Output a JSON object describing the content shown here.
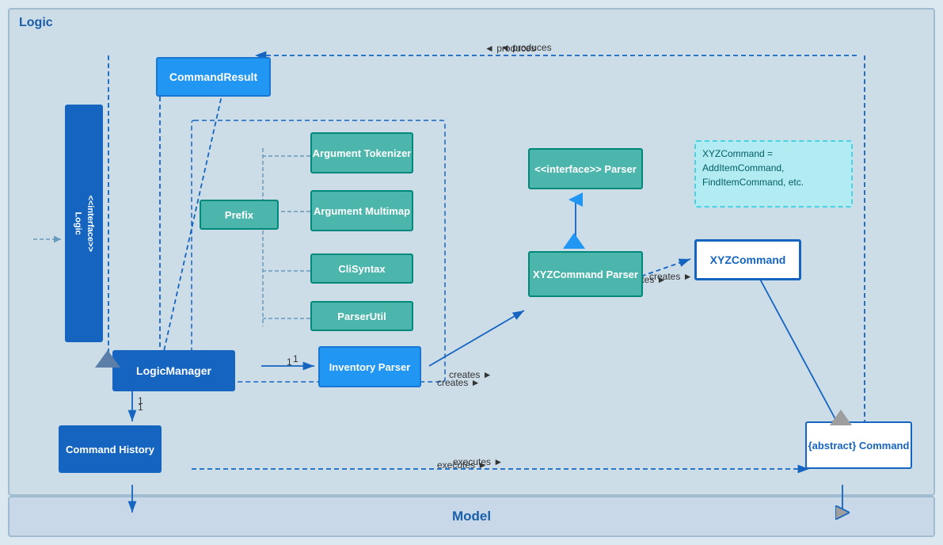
{
  "diagram": {
    "title": "Logic",
    "model_label": "Model",
    "boxes": {
      "command_result": "CommandResult",
      "logic_interface": "<<interface>>\nLogic",
      "argument_tokenizer": "Argument\nTokenizer",
      "argument_multimap": "Argument\nMultimap",
      "prefix": "Prefix",
      "cli_syntax": "CliSyntax",
      "parser_util": "ParserUtil",
      "logic_manager": "LogicManager",
      "inventory_parser": "Inventory\nParser",
      "parser_interface": "<<interface>>\nParser",
      "xyz_command_parser": "XYZCommand\nParser",
      "xyz_command": "XYZCommand",
      "abstract_command": "{abstract}\nCommand",
      "command_history": "Command\nHistory",
      "xyz_note": "XYZCommand =\nAddItemCommand,\nFindItemCommand, etc."
    },
    "labels": {
      "produces": "◄ produces",
      "creates1": "creates ►",
      "creates2": "creates ►",
      "executes": "executes ►",
      "one1": "1",
      "one2": "1"
    }
  }
}
